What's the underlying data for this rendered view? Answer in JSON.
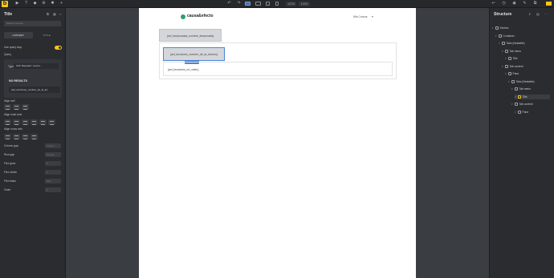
{
  "toolbar": {
    "logo_label": "b",
    "zoom_value": "1200",
    "width_value": "1200"
  },
  "left_panel": {
    "title": "Title",
    "search_placeholder": "Search controls",
    "tabs": [
      {
        "label": "CONTENT"
      },
      {
        "label": "STYLE"
      }
    ],
    "use_query_loop_label": "Use query loop",
    "query_label": "Query",
    "type_label": "Type",
    "type_value": "ACF Repeater: Leccio...",
    "no_results_label": "NO RESULTS",
    "query_item_text": "{acf_lecciones_nombre_de_la_lec",
    "align_self_label": "Align self",
    "align_main_axis_label": "Align main axis",
    "align_cross_axis_label": "Align cross axis",
    "fields": [
      {
        "label": "Column gap",
        "placeholder": "Column"
      },
      {
        "label": "Row gap",
        "placeholder": "Generic"
      },
      {
        "label": "Flex grow",
        "placeholder": "0"
      },
      {
        "label": "Flex shrink",
        "placeholder": "1"
      },
      {
        "label": "Flex basis",
        "placeholder": "auto"
      },
      {
        "label": "Order",
        "placeholder": "0"
      }
    ]
  },
  "canvas": {
    "brand_name": "causa&efecto",
    "lang_selector": "Mis Cursos",
    "template_block_text": "{acf_temporadas_nombre_temporada}",
    "tab_title_text": "{acf_lecciones_nombre_de_la_leccion}",
    "tab_content_text": "{acf_lecciones_url_video}"
  },
  "structure": {
    "title": "Structure",
    "items": [
      {
        "label": "Section",
        "indent": 0,
        "active": false
      },
      {
        "label": "Container",
        "indent": 1,
        "active": false
      },
      {
        "label": "Tabs (Nestable)",
        "indent": 2,
        "active": false
      },
      {
        "label": "Tab menu",
        "indent": 3,
        "active": false
      },
      {
        "label": "Title",
        "indent": 4,
        "active": false
      },
      {
        "label": "Tab content",
        "indent": 3,
        "active": false
      },
      {
        "label": "Pane",
        "indent": 4,
        "active": false
      },
      {
        "label": "Tabs (Nestable)",
        "indent": 5,
        "active": false
      },
      {
        "label": "Tab menu",
        "indent": 6,
        "active": false
      },
      {
        "label": "Title",
        "indent": 7,
        "active": true
      },
      {
        "label": "Tab content",
        "indent": 6,
        "active": false
      },
      {
        "label": "Pane",
        "indent": 7,
        "active": false
      }
    ]
  },
  "colors": {
    "accent": "#f5c518",
    "selection": "#4b84d6",
    "panel_bg": "#2a2c30"
  }
}
